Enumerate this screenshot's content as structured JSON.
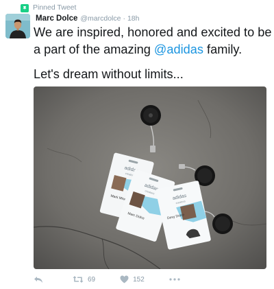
{
  "pinned": {
    "label": "Pinned Tweet"
  },
  "author": {
    "name": "Marc Dolce",
    "handle": "@marcdolce",
    "time": "18h"
  },
  "tweet": {
    "line1": "We are inspired, honored and excited to be",
    "line2_prefix": "a part of the amazing ",
    "line2_mention": "@adidas",
    "line2_suffix": " family.",
    "line3": "Let's dream without limits..."
  },
  "photo": {
    "badges": [
      {
        "brand": "adidas",
        "sub": "creators",
        "name": "Mark Miner"
      },
      {
        "brand": "adidas",
        "sub": "creators",
        "name": "Marc Dolce"
      },
      {
        "brand": "adidas",
        "sub": "creators",
        "name": "Desy Dolce"
      }
    ]
  },
  "actions": {
    "retweets": "69",
    "likes": "152"
  },
  "colors": {
    "link": "#1b95e0",
    "muted": "#8899a6",
    "icon": "#aab8c2",
    "pin": "#19cf86"
  }
}
